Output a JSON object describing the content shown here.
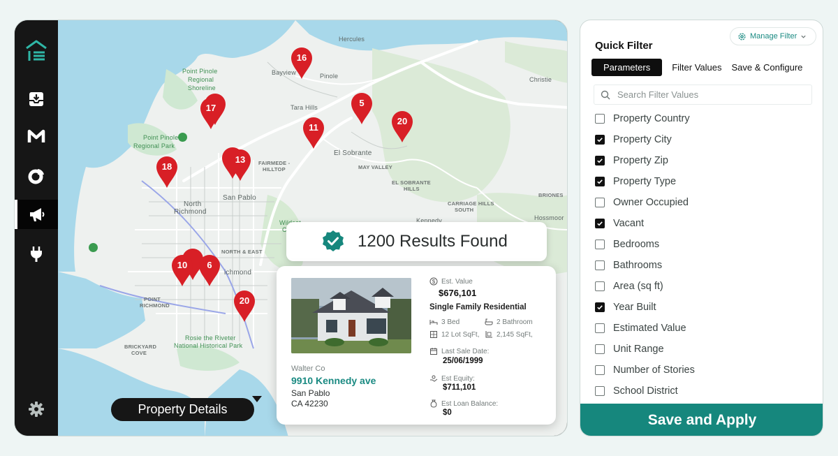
{
  "sidebar": {
    "items": [
      {
        "icon": "inbox-download-icon"
      },
      {
        "icon": "m-logo-icon"
      },
      {
        "icon": "donut-chart-icon"
      },
      {
        "icon": "megaphone-icon"
      },
      {
        "icon": "plug-icon"
      },
      {
        "icon": "gear-icon"
      }
    ],
    "active_index": 3
  },
  "map": {
    "places": {
      "hercules": "Hercules",
      "bayview": "Bayview",
      "pinole": "Pinole",
      "christie": "Christie",
      "point_pinole_shoreline_1": "Point Pinole",
      "point_pinole_shoreline_2": "Regional",
      "point_pinole_shoreline_3": "Shoreline",
      "tara_hills": "Tara Hills",
      "point_pinole_park_1": "Point Pinole",
      "point_pinole_park_2": "Regional Park",
      "fairmede_1": "FAIRMEDE -",
      "fairmede_2": "HILLTOP",
      "el_sobrante": "El Sobrante",
      "may_valley": "MAY VALLEY",
      "el_sobrante_hills_1": "EL SOBRANTE",
      "el_sobrante_hills_2": "HILLS",
      "briones": "BRIONES",
      "san_pablo": "San Pablo",
      "north_richmond_1": "North",
      "north_richmond_2": "Richmond",
      "carriage_hills_1": "CARRIAGE HILLS",
      "carriage_hills_2": "SOUTH",
      "hossmoor": "Hossmoor",
      "wildcat_1": "Wildcat",
      "wildcat_2": "Canyo",
      "kennedy": "Kennedy",
      "north_east": "NORTH & EAST",
      "richmond": "ichmond",
      "point_richmond_1": "POINT",
      "point_richmond_2": "RICHMOND",
      "rosie_1": "Rosie the Riveter",
      "rosie_2": "National Historical Park",
      "brickyard_1": "BRICKYARD",
      "brickyard_2": "COVE"
    },
    "pins": [
      {
        "label": "16"
      },
      {
        "label": "17"
      },
      {
        "label": "5"
      },
      {
        "label": "20"
      },
      {
        "label": "11"
      },
      {
        "label": "13"
      },
      {
        "label": "18"
      },
      {
        "label": "10"
      },
      {
        "label": "6"
      },
      {
        "label": "20"
      }
    ]
  },
  "results": {
    "text": "1200 Results Found"
  },
  "property": {
    "owner": "Walter Co",
    "address": "9910 Kennedy ave",
    "city": "San Pablo",
    "state_zip": "CA 42230",
    "est_value_label": "Est. Value",
    "est_value": "$676,101",
    "type": "Single Family Residential",
    "beds": "3 Bed",
    "baths": "2 Bathroom",
    "lot": "12 Lot SqFt,",
    "sqft": "2,145 SqFt,",
    "last_sale_label": "Last Sale Date:",
    "last_sale": "25/06/1999",
    "equity_label": "Est Equity:",
    "equity": "$711,101",
    "loan_label": "Est Loan Balance:",
    "loan": "$0"
  },
  "details_button": "Property Details",
  "filter_panel": {
    "manage_filter": "Manage Filter",
    "title": "Quick Filter",
    "tabs": [
      "Parameters",
      "Filter Values",
      "Save & Configure"
    ],
    "active_tab": 0,
    "search_placeholder": "Search Filter Values",
    "options": [
      {
        "label": "Property Country",
        "checked": false
      },
      {
        "label": "Property City",
        "checked": true
      },
      {
        "label": "Property Zip",
        "checked": true
      },
      {
        "label": "Property Type",
        "checked": true
      },
      {
        "label": "Owner Occupied",
        "checked": false
      },
      {
        "label": "Vacant",
        "checked": true
      },
      {
        "label": "Bedrooms",
        "checked": false
      },
      {
        "label": "Bathrooms",
        "checked": false
      },
      {
        "label": "Area (sq ft)",
        "checked": false
      },
      {
        "label": "Year Built",
        "checked": true
      },
      {
        "label": "Estimated Value",
        "checked": false
      },
      {
        "label": "Unit Range",
        "checked": false
      },
      {
        "label": "Number of Stories",
        "checked": false
      },
      {
        "label": "School District",
        "checked": false
      }
    ],
    "apply_button": "Save and Apply"
  },
  "colors": {
    "accent": "#16877d",
    "pin": "#d81f26",
    "water": "#a8d8ea",
    "sidebar": "#161616"
  }
}
